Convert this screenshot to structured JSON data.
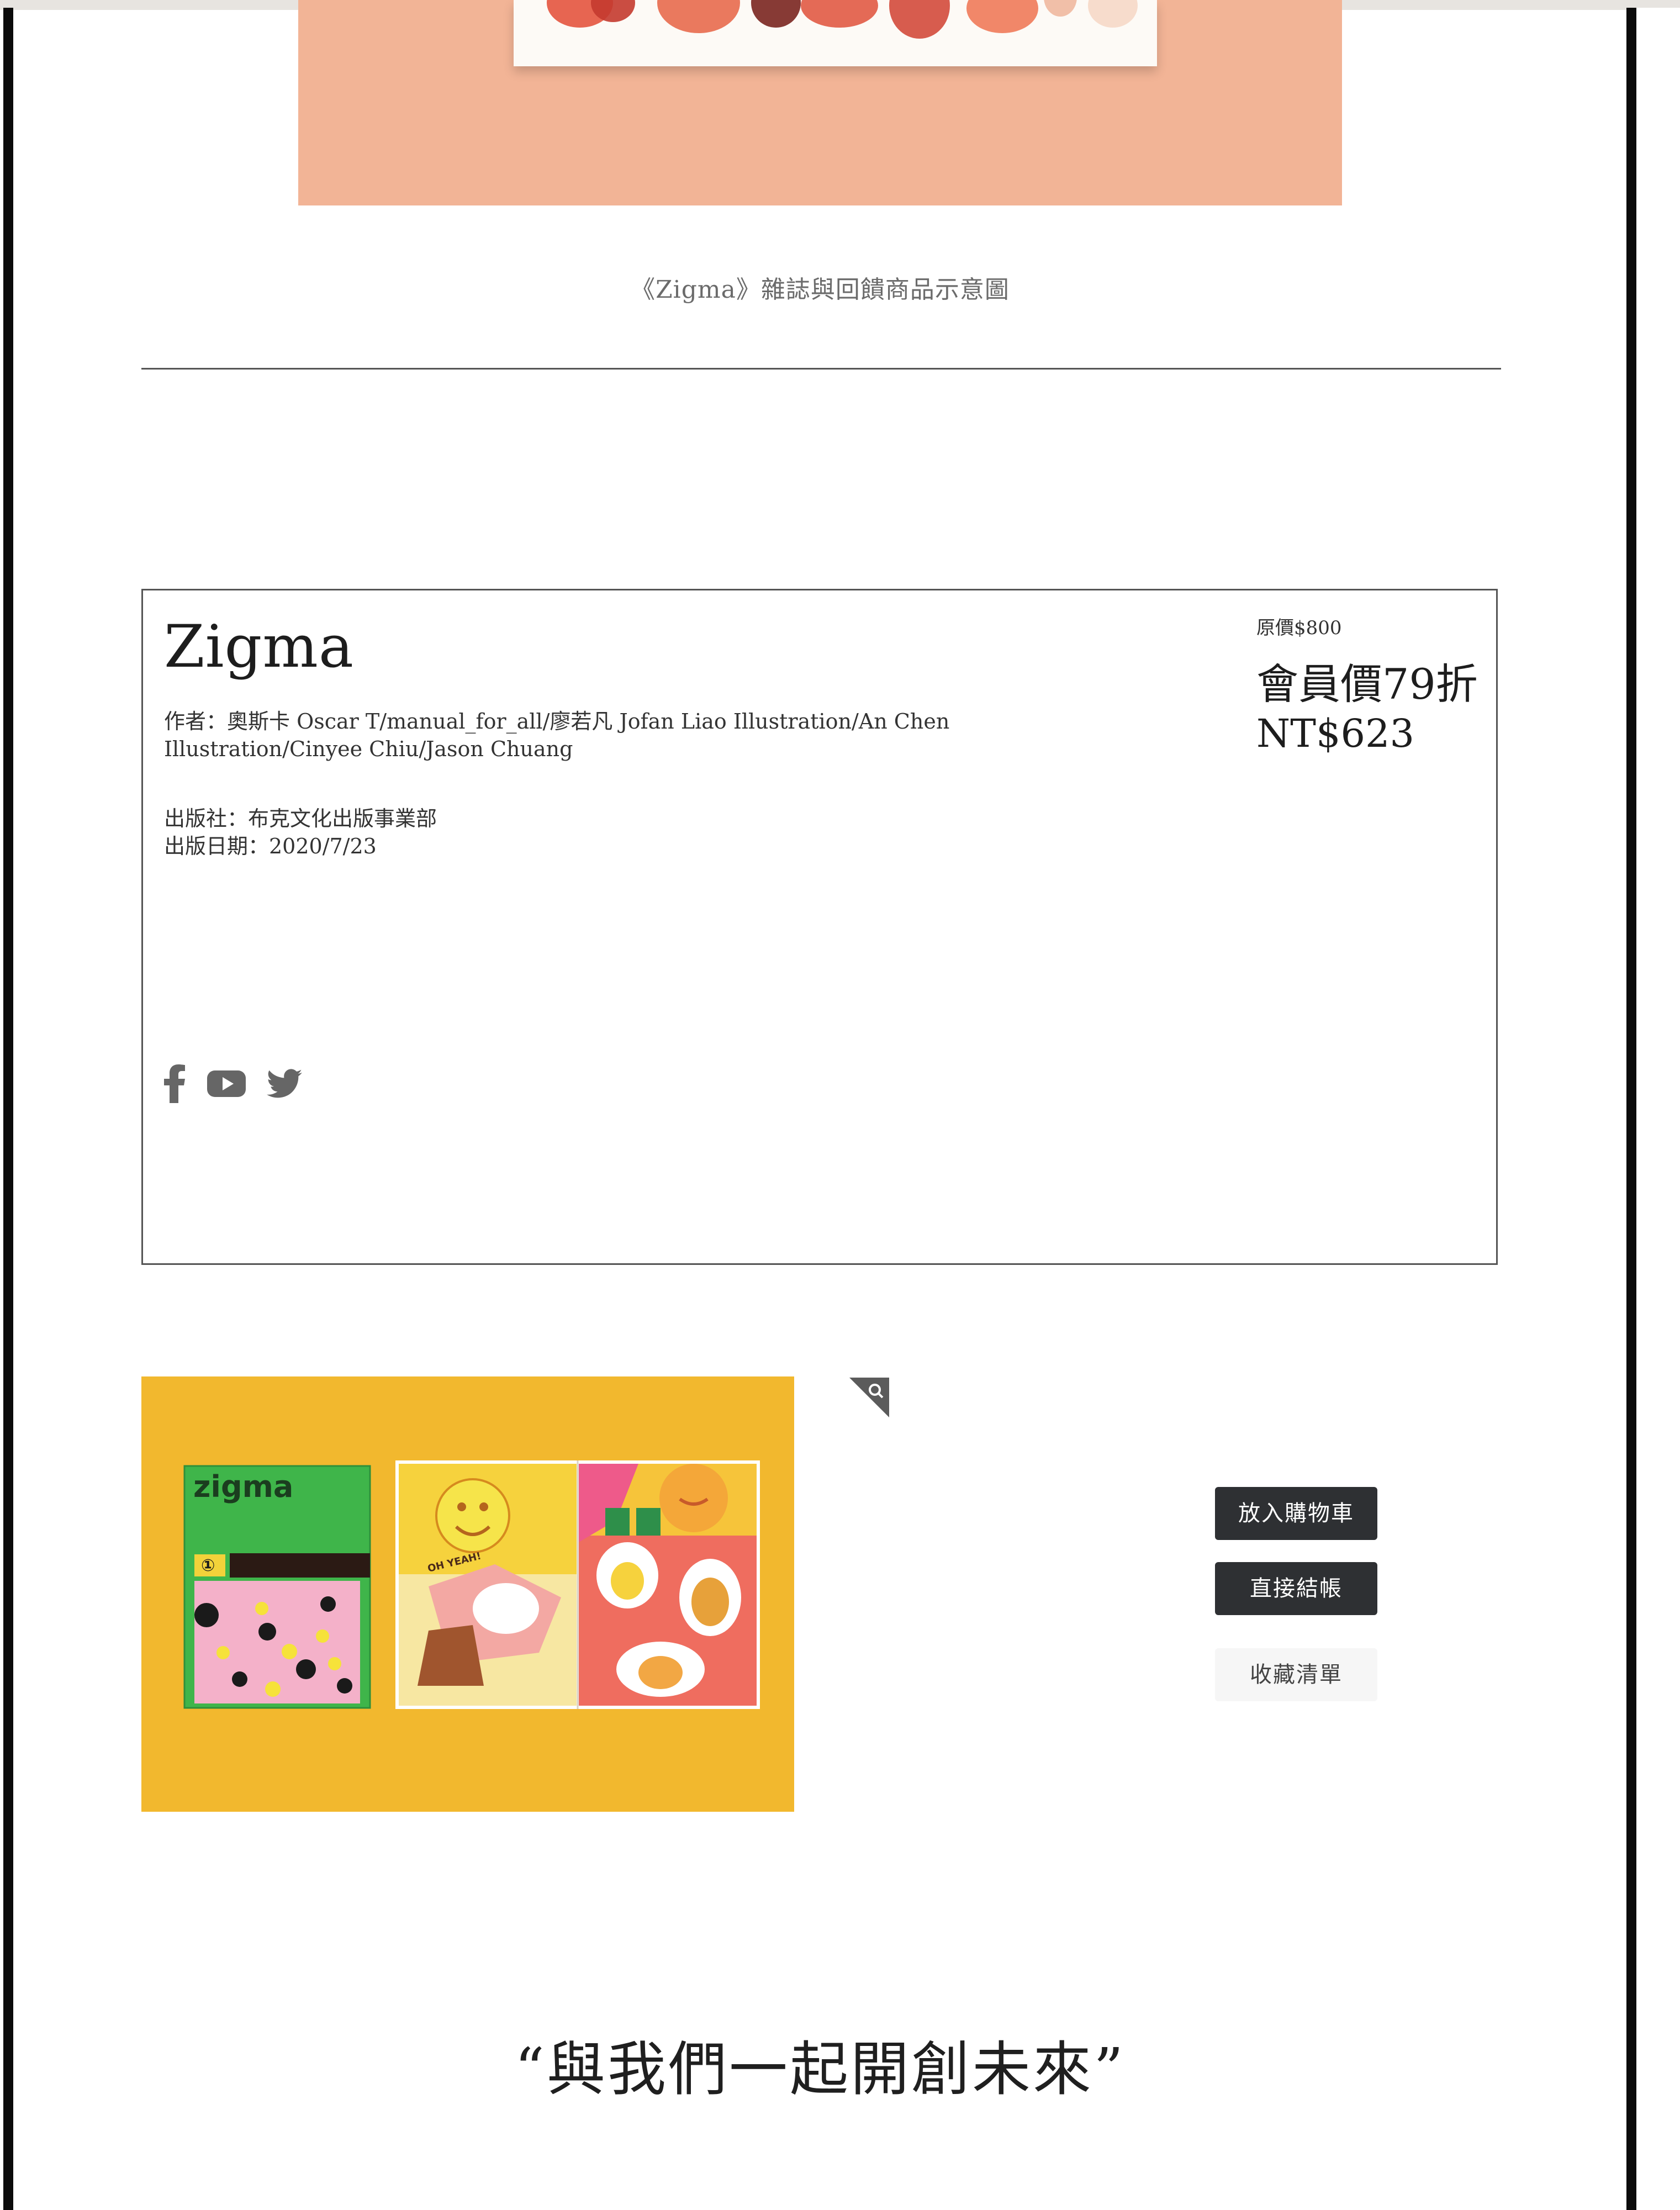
{
  "hero": {
    "image_alt": "Zigma magazine illustrated cover",
    "background_color": "#f2b496"
  },
  "caption": "《Zigma》雜誌與回饋商品示意圖",
  "product": {
    "title": "Zigma",
    "authors": "作者：奧斯卡 Oscar T/manual_for_all/廖若凡 Jofan Liao Illustration/An Chen Illustration/Cinyee Chiu/Jason Chuang",
    "publisher": "出版社：布克文化出版事業部",
    "publish_date": "出版日期：2020/7/23",
    "original_price": "原價$800",
    "member_price": "會員價79折",
    "price": "NT$623",
    "social_icons": [
      "facebook-icon",
      "youtube-icon",
      "twitter-icon"
    ]
  },
  "photo": {
    "background_color": "#f2b82e",
    "magazine_logo": "zigma",
    "issue_number": "①",
    "speech_text": "OH YEAH!"
  },
  "actions": {
    "add_to_cart": "放入購物車",
    "checkout": "直接結帳",
    "wishlist": "收藏清單"
  },
  "quote": "“與我們一起開創未來”"
}
